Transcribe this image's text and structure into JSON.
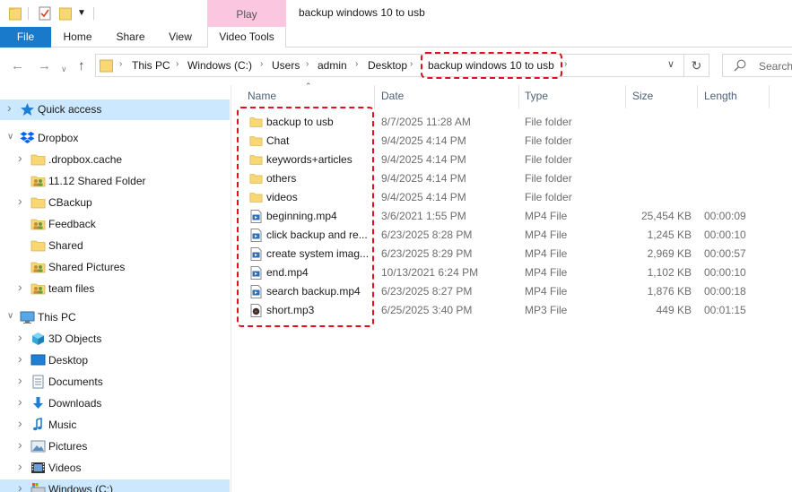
{
  "titlebar": {
    "play_tab": "Play",
    "window_title": "backup windows 10 to usb"
  },
  "ribbon": {
    "tabs": [
      "File",
      "Home",
      "Share",
      "View",
      "Video Tools"
    ]
  },
  "address": {
    "breadcrumbs": [
      "This PC",
      "Windows (C:)",
      "Users",
      "admin",
      "Desktop",
      "backup windows 10 to usb"
    ],
    "search_placeholder": "Search"
  },
  "navpane": {
    "items": [
      {
        "label": "Quick access",
        "icon": "star-icon",
        "selected": true,
        "expander": "collapsed"
      },
      {
        "label": "Dropbox",
        "icon": "dropbox-icon",
        "selected": false,
        "expander": "expanded"
      },
      {
        "label": ".dropbox.cache",
        "icon": "folder-icon",
        "selected": false,
        "expander": "collapsed"
      },
      {
        "label": "11.12 Shared Folder",
        "icon": "shared-folder-icon",
        "selected": false,
        "expander": "none"
      },
      {
        "label": "CBackup",
        "icon": "folder-icon",
        "selected": false,
        "expander": "collapsed"
      },
      {
        "label": "Feedback",
        "icon": "shared-folder-icon",
        "selected": false,
        "expander": "none"
      },
      {
        "label": "Shared",
        "icon": "folder-icon",
        "selected": false,
        "expander": "none"
      },
      {
        "label": "Shared Pictures",
        "icon": "shared-folder-icon",
        "selected": false,
        "expander": "none"
      },
      {
        "label": "team files",
        "icon": "shared-folder-icon",
        "selected": false,
        "expander": "collapsed"
      },
      {
        "label": "This PC",
        "icon": "computer-icon",
        "selected": false,
        "expander": "expanded"
      },
      {
        "label": "3D Objects",
        "icon": "cube-icon",
        "selected": false,
        "expander": "collapsed"
      },
      {
        "label": "Desktop",
        "icon": "desktop-icon",
        "selected": false,
        "expander": "collapsed"
      },
      {
        "label": "Documents",
        "icon": "documents-icon",
        "selected": false,
        "expander": "collapsed"
      },
      {
        "label": "Downloads",
        "icon": "download-icon",
        "selected": false,
        "expander": "collapsed"
      },
      {
        "label": "Music",
        "icon": "music-icon",
        "selected": false,
        "expander": "collapsed"
      },
      {
        "label": "Pictures",
        "icon": "pictures-icon",
        "selected": false,
        "expander": "collapsed"
      },
      {
        "label": "Videos",
        "icon": "videos-icon",
        "selected": false,
        "expander": "collapsed"
      },
      {
        "label": "Windows (C:)",
        "icon": "drive-icon",
        "selected": true,
        "expander": "collapsed"
      }
    ]
  },
  "filelist": {
    "columns": [
      "Name",
      "Date",
      "Type",
      "Size",
      "Length"
    ],
    "rows": [
      {
        "name": "backup to usb",
        "date": "8/7/2025 11:28 AM",
        "type": "File folder",
        "size": "",
        "length": "",
        "icon": "folder-icon"
      },
      {
        "name": "Chat",
        "date": "9/4/2025 4:14 PM",
        "type": "File folder",
        "size": "",
        "length": "",
        "icon": "folder-icon"
      },
      {
        "name": "keywords+articles",
        "date": "9/4/2025 4:14 PM",
        "type": "File folder",
        "size": "",
        "length": "",
        "icon": "folder-icon"
      },
      {
        "name": "others",
        "date": "9/4/2025 4:14 PM",
        "type": "File folder",
        "size": "",
        "length": "",
        "icon": "folder-icon"
      },
      {
        "name": "videos",
        "date": "9/4/2025 4:14 PM",
        "type": "File folder",
        "size": "",
        "length": "",
        "icon": "folder-icon"
      },
      {
        "name": "beginning.mp4",
        "date": "3/6/2021 1:55 PM",
        "type": "MP4 File",
        "size": "25,454 KB",
        "length": "00:00:09",
        "icon": "video-file-icon"
      },
      {
        "name": "click backup and re...",
        "date": "6/23/2025 8:28 PM",
        "type": "MP4 File",
        "size": "1,245 KB",
        "length": "00:00:10",
        "icon": "video-file-icon"
      },
      {
        "name": "create system imag...",
        "date": "6/23/2025 8:29 PM",
        "type": "MP4 File",
        "size": "2,969 KB",
        "length": "00:00:57",
        "icon": "video-file-icon"
      },
      {
        "name": "end.mp4",
        "date": "10/13/2021 6:24 PM",
        "type": "MP4 File",
        "size": "1,102 KB",
        "length": "00:00:10",
        "icon": "video-file-icon"
      },
      {
        "name": "search backup.mp4",
        "date": "6/23/2025 8:27 PM",
        "type": "MP4 File",
        "size": "1,876 KB",
        "length": "00:00:18",
        "icon": "video-file-icon"
      },
      {
        "name": "short.mp3",
        "date": "6/25/2025 3:40 PM",
        "type": "MP3 File",
        "size": "449 KB",
        "length": "00:01:15",
        "icon": "audio-file-icon"
      }
    ]
  },
  "colors": {
    "file_tab": "#1979ca",
    "play_tab": "#fbc7e0",
    "selection": "#cce8ff",
    "highlight_box": "#e0101e",
    "folder": "#f8d775"
  }
}
